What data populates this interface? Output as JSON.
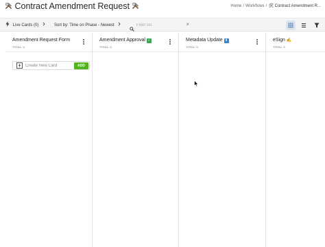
{
  "header": {
    "title": "Contract Amendment Request",
    "title_icon": "hammer-wrench-icon",
    "breadcrumb": [
      {
        "label": "Home"
      },
      {
        "label": "Workflows"
      },
      {
        "label": "🛠 Contract Amendment R..."
      }
    ]
  },
  "toolbar": {
    "live_cards_label": "Live Cards (0)",
    "sort_label": "Sort by: Time on Phase - Newest",
    "filter_placeholder": "Filter list",
    "filter_value": ""
  },
  "columns": [
    {
      "title": "Amendment Request Form",
      "emoji": "",
      "total": "TOTAL: 0"
    },
    {
      "title": "Amendment Approval",
      "emoji": "check-mark-button-icon",
      "total": "TOTAL: 0"
    },
    {
      "title": "Metadata Update",
      "emoji": "up-arrow-button-icon",
      "total": "TOTAL: 0"
    },
    {
      "title": "eSign",
      "emoji": "writing-hand-icon",
      "total": "TOTAL: 0"
    }
  ],
  "create_card": {
    "placeholder": "Create New Card",
    "add_label": "ADD"
  },
  "colors": {
    "accent_green": "#55b320",
    "toolbar_bg": "#f3f4f6",
    "active_view_bg": "#dde3ea"
  }
}
